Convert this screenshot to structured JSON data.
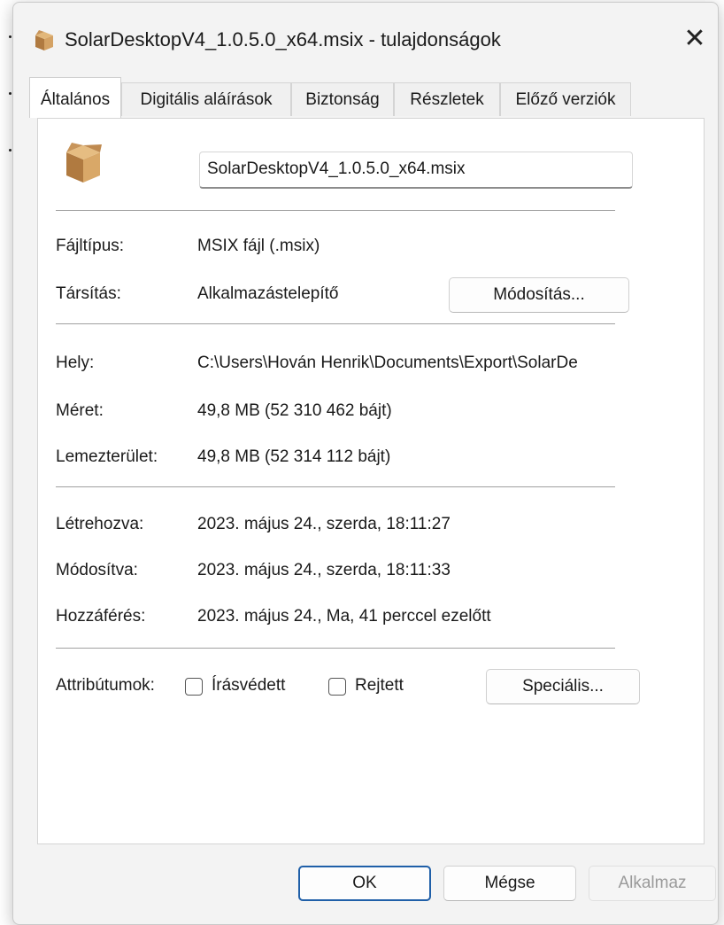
{
  "window": {
    "title": "SolarDesktopV4_1.0.5.0_x64.msix - tulajdonságok",
    "close_glyph": "✕"
  },
  "tabs": [
    {
      "label": "Általános",
      "active": true
    },
    {
      "label": "Digitális aláírások",
      "active": false
    },
    {
      "label": "Biztonság",
      "active": false
    },
    {
      "label": "Részletek",
      "active": false
    },
    {
      "label": "Előző verziók",
      "active": false
    }
  ],
  "general": {
    "file_name": "SolarDesktopV4_1.0.5.0_x64.msix",
    "file_type_label": "Fájltípus:",
    "file_type_value": "MSIX fájl (.msix)",
    "assoc_label": "Társítás:",
    "assoc_value": "Alkalmazástelepítő",
    "change_button": "Módosítás...",
    "location_label": "Hely:",
    "location_value": "C:\\Users\\Hován Henrik\\Documents\\Export\\SolarDe",
    "size_label": "Méret:",
    "size_value": "49,8 MB (52 310 462 bájt)",
    "disk_label": "Lemezterület:",
    "disk_value": "49,8 MB (52 314 112 bájt)",
    "created_label": "Létrehozva:",
    "created_value": "2023. május 24., szerda, 18:11:27",
    "modified_label": "Módosítva:",
    "modified_value": "2023. május 24., szerda, 18:11:33",
    "accessed_label": "Hozzáférés:",
    "accessed_value": "2023. május 24., Ma, 41 perccel ezelőtt",
    "attributes_label": "Attribútumok:",
    "readonly_label": "Írásvédett",
    "readonly_checked": false,
    "hidden_label": "Rejtett",
    "hidden_checked": false,
    "advanced_button": "Speciális..."
  },
  "footer": {
    "ok": "OK",
    "cancel": "Mégse",
    "apply": "Alkalmaz"
  },
  "colors": {
    "accent_border": "#1f5fa8",
    "package_icon": "#c8955a"
  }
}
